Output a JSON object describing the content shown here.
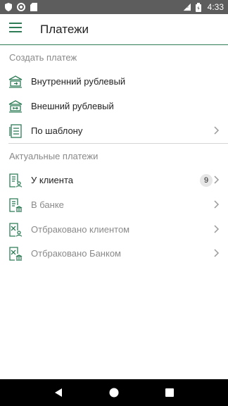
{
  "status_bar": {
    "time": "4:33",
    "left_icons": [
      "shield-icon",
      "circle-icon",
      "sim-card-icon"
    ],
    "right_icons": [
      "lte-icon",
      "battery-icon"
    ],
    "lte": "LTE"
  },
  "app_bar": {
    "title": "Платежи",
    "menu_icon": "menu-icon"
  },
  "sections": [
    {
      "header": "Создать платеж",
      "items": [
        {
          "label": "Внутренний рублевый",
          "icon": "bank-transfer-internal-icon",
          "chevron": false,
          "badge": null
        },
        {
          "label": "Внешний рублевый",
          "icon": "bank-transfer-external-icon",
          "chevron": false,
          "badge": null
        },
        {
          "label": "По шаблону",
          "icon": "template-icon",
          "chevron": true,
          "badge": null
        }
      ]
    },
    {
      "header": "Актуальные платежи",
      "items": [
        {
          "label": "У клиента",
          "icon": "document-user-icon",
          "chevron": true,
          "badge": "9",
          "dim": false
        },
        {
          "label": "В банке",
          "icon": "document-bank-icon",
          "chevron": true,
          "badge": null,
          "dim": true
        },
        {
          "label": "Отбраковано клиентом",
          "icon": "document-rejected-client-icon",
          "chevron": true,
          "badge": null,
          "dim": true
        },
        {
          "label": "Отбраковано Банком",
          "icon": "document-rejected-bank-icon",
          "chevron": true,
          "badge": null,
          "dim": true
        }
      ]
    }
  ],
  "colors": {
    "accent": "#2e7d57",
    "status_bar": "#5d5d5d",
    "nav_bar": "#000000",
    "muted_text": "#8a8a8a"
  },
  "nav_bar": {
    "buttons": [
      "back-icon",
      "home-icon",
      "recents-icon"
    ]
  }
}
